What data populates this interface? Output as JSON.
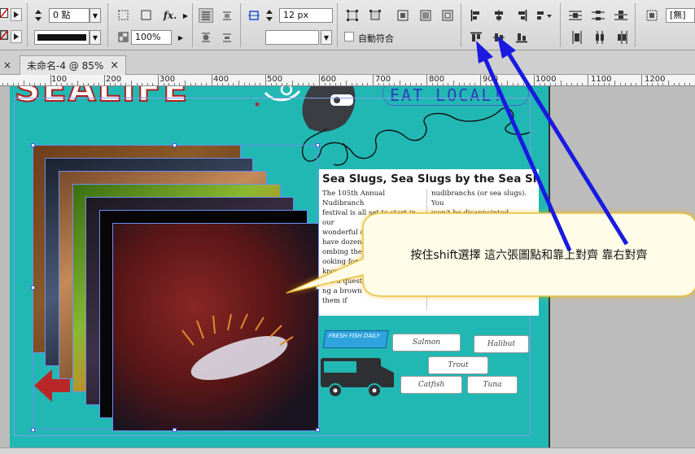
{
  "control_panel": {
    "stroke_weight": "0 點",
    "scale_percent": "100%",
    "spacing_value": "12 px",
    "auto_fit_label": "自動符合",
    "cell_options_label": "[無]"
  },
  "tabs": [
    {
      "title": "未命名-4 @ 85%",
      "close": "×"
    }
  ],
  "ruler": {
    "labels": [
      "100",
      "200",
      "300",
      "400",
      "500",
      "600",
      "700",
      "800",
      "900",
      "1000",
      "1100",
      "1200"
    ]
  },
  "document": {
    "logo_text": "SEALIFE",
    "banner_text": "EAT LOCAL!",
    "article_title": "Sea Slugs, Sea Slugs by the Sea Shore",
    "article_col1": [
      "The 105th Annual Nudibranch",
      "festival is all set to start in our",
      "wonderful community. We'll",
      "have dozens of best",
      "ombing the sh",
      "ooking for som",
      "knowledge with",
      "ave a question",
      "ng a brown",
      "them if"
    ],
    "article_col2": [
      "nudibranchs (or sea slugs). You",
      "won't be disappointed. You'll learn"
    ],
    "food_labels": {
      "salmon": "Salmon",
      "halibut": "Halibut",
      "trout": "Trout",
      "catfish": "Catfish",
      "tuna": "Tuna"
    },
    "truck_sign": "FRESH FISH DAILY"
  },
  "annotation": {
    "callout": "按住shift選擇 這六張圖點和靠上對齊 靠右對齊",
    "arrow_color": "#1a1ae0"
  },
  "colors": {
    "page_bg": "#21b8b4",
    "frame_blue": "#6f8df0",
    "callout_fill": "#fffde8",
    "callout_glow": "#f3b300"
  }
}
